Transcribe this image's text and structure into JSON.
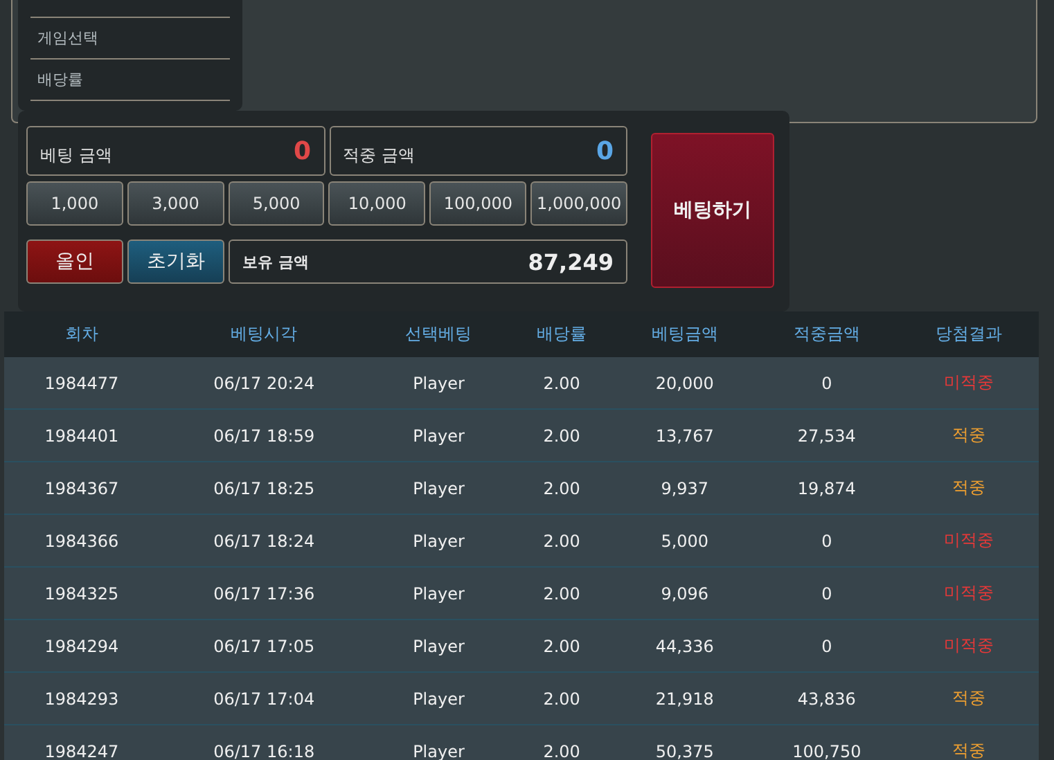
{
  "menu": {
    "items": [
      "게임선택",
      "배당률"
    ]
  },
  "bet_panel": {
    "bet_amount": {
      "label": "베팅 금액",
      "value": "0"
    },
    "win_amount": {
      "label": "적중 금액",
      "value": "0"
    },
    "chips": [
      "1,000",
      "3,000",
      "5,000",
      "10,000",
      "100,000",
      "1,000,000"
    ],
    "allin_button": "올인",
    "reset_button": "초기화",
    "balance": {
      "label": "보유 금액",
      "value": "87,249"
    },
    "bet_button": "베팅하기"
  },
  "table": {
    "columns": [
      "회차",
      "베팅시각",
      "선택베팅",
      "배당률",
      "베팅금액",
      "적중금액",
      "당첨결과"
    ],
    "rows": [
      {
        "cells": [
          "1984477",
          "06/17 20:24",
          "Player",
          "2.00",
          "20,000",
          "0"
        ],
        "result": "미적중",
        "won": false
      },
      {
        "cells": [
          "1984401",
          "06/17 18:59",
          "Player",
          "2.00",
          "13,767",
          "27,534"
        ],
        "result": "적중",
        "won": true
      },
      {
        "cells": [
          "1984367",
          "06/17 18:25",
          "Player",
          "2.00",
          "9,937",
          "19,874"
        ],
        "result": "적중",
        "won": true
      },
      {
        "cells": [
          "1984366",
          "06/17 18:24",
          "Player",
          "2.00",
          "5,000",
          "0"
        ],
        "result": "미적중",
        "won": false
      },
      {
        "cells": [
          "1984325",
          "06/17 17:36",
          "Player",
          "2.00",
          "9,096",
          "0"
        ],
        "result": "미적중",
        "won": false
      },
      {
        "cells": [
          "1984294",
          "06/17 17:05",
          "Player",
          "2.00",
          "44,336",
          "0"
        ],
        "result": "미적중",
        "won": false
      },
      {
        "cells": [
          "1984293",
          "06/17 17:04",
          "Player",
          "2.00",
          "21,918",
          "43,836"
        ],
        "result": "적중",
        "won": true
      },
      {
        "cells": [
          "1984247",
          "06/17 16:18",
          "Player",
          "2.00",
          "50,375",
          "100,750"
        ],
        "result": "적중",
        "won": true
      }
    ]
  }
}
